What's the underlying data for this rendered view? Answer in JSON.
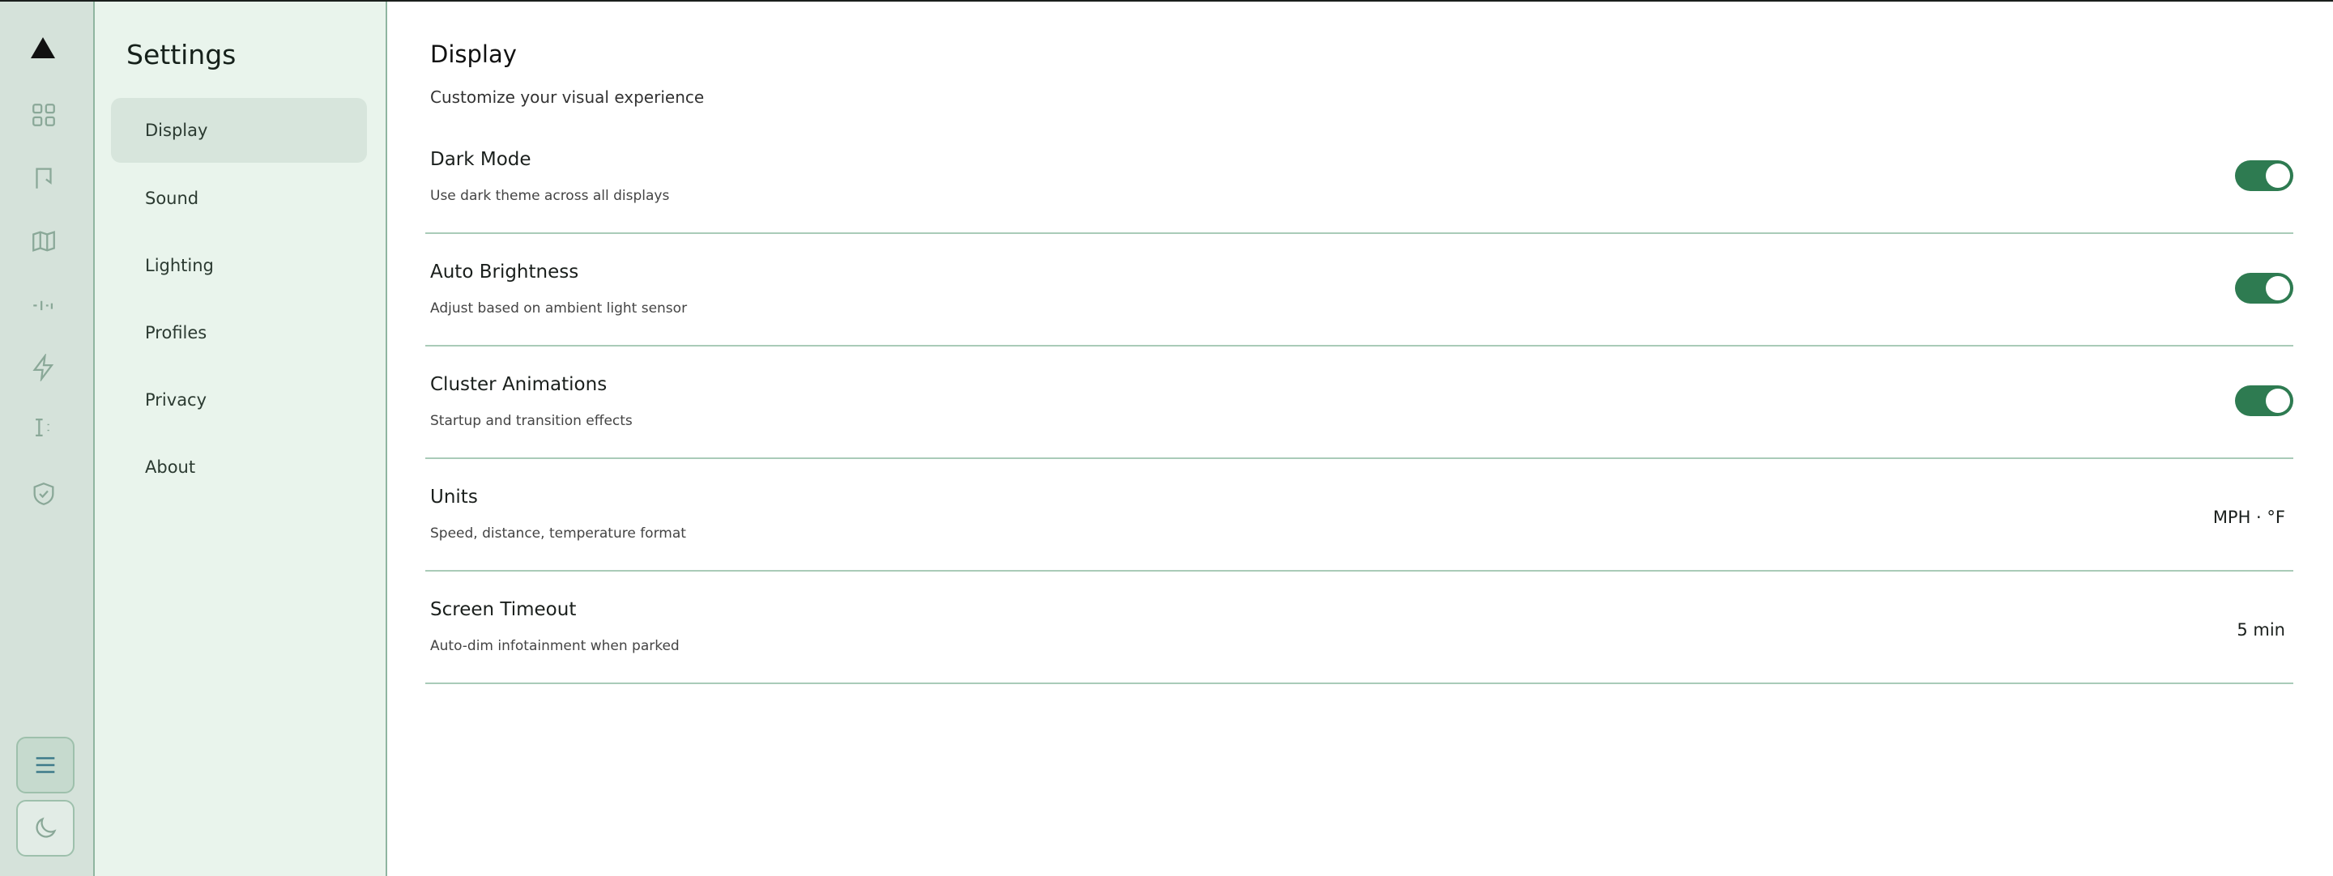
{
  "rail": {
    "icons": [
      "logo-icon",
      "apps-grid-icon",
      "bookmark-icon",
      "map-icon",
      "stats-icon",
      "bolt-icon",
      "parking-icon",
      "shield-check-icon",
      "menu-icon",
      "moon-icon"
    ]
  },
  "sidebar": {
    "title": "Settings",
    "items": [
      {
        "label": "Display",
        "active": true
      },
      {
        "label": "Sound",
        "active": false
      },
      {
        "label": "Lighting",
        "active": false
      },
      {
        "label": "Profiles",
        "active": false
      },
      {
        "label": "Privacy",
        "active": false
      },
      {
        "label": "About",
        "active": false
      }
    ]
  },
  "main": {
    "title": "Display",
    "subtitle": "Customize your visual experience",
    "rows": [
      {
        "title": "Dark Mode",
        "desc": "Use dark theme across all displays",
        "toggle": true
      },
      {
        "title": "Auto Brightness",
        "desc": "Adjust based on ambient light sensor",
        "toggle": true
      },
      {
        "title": "Cluster Animations",
        "desc": "Startup and transition effects",
        "toggle": true
      },
      {
        "title": "Units",
        "desc": "Speed, distance, temperature format",
        "value": "MPH · °F"
      },
      {
        "title": "Screen Timeout",
        "desc": "Auto-dim infotainment when parked",
        "value": "5 min"
      }
    ]
  },
  "colors": {
    "accent": "#2e7b51",
    "sidebar_bg": "#e9f4ec",
    "rail_bg": "#d5e2da",
    "divider": "#a9cbb8"
  }
}
